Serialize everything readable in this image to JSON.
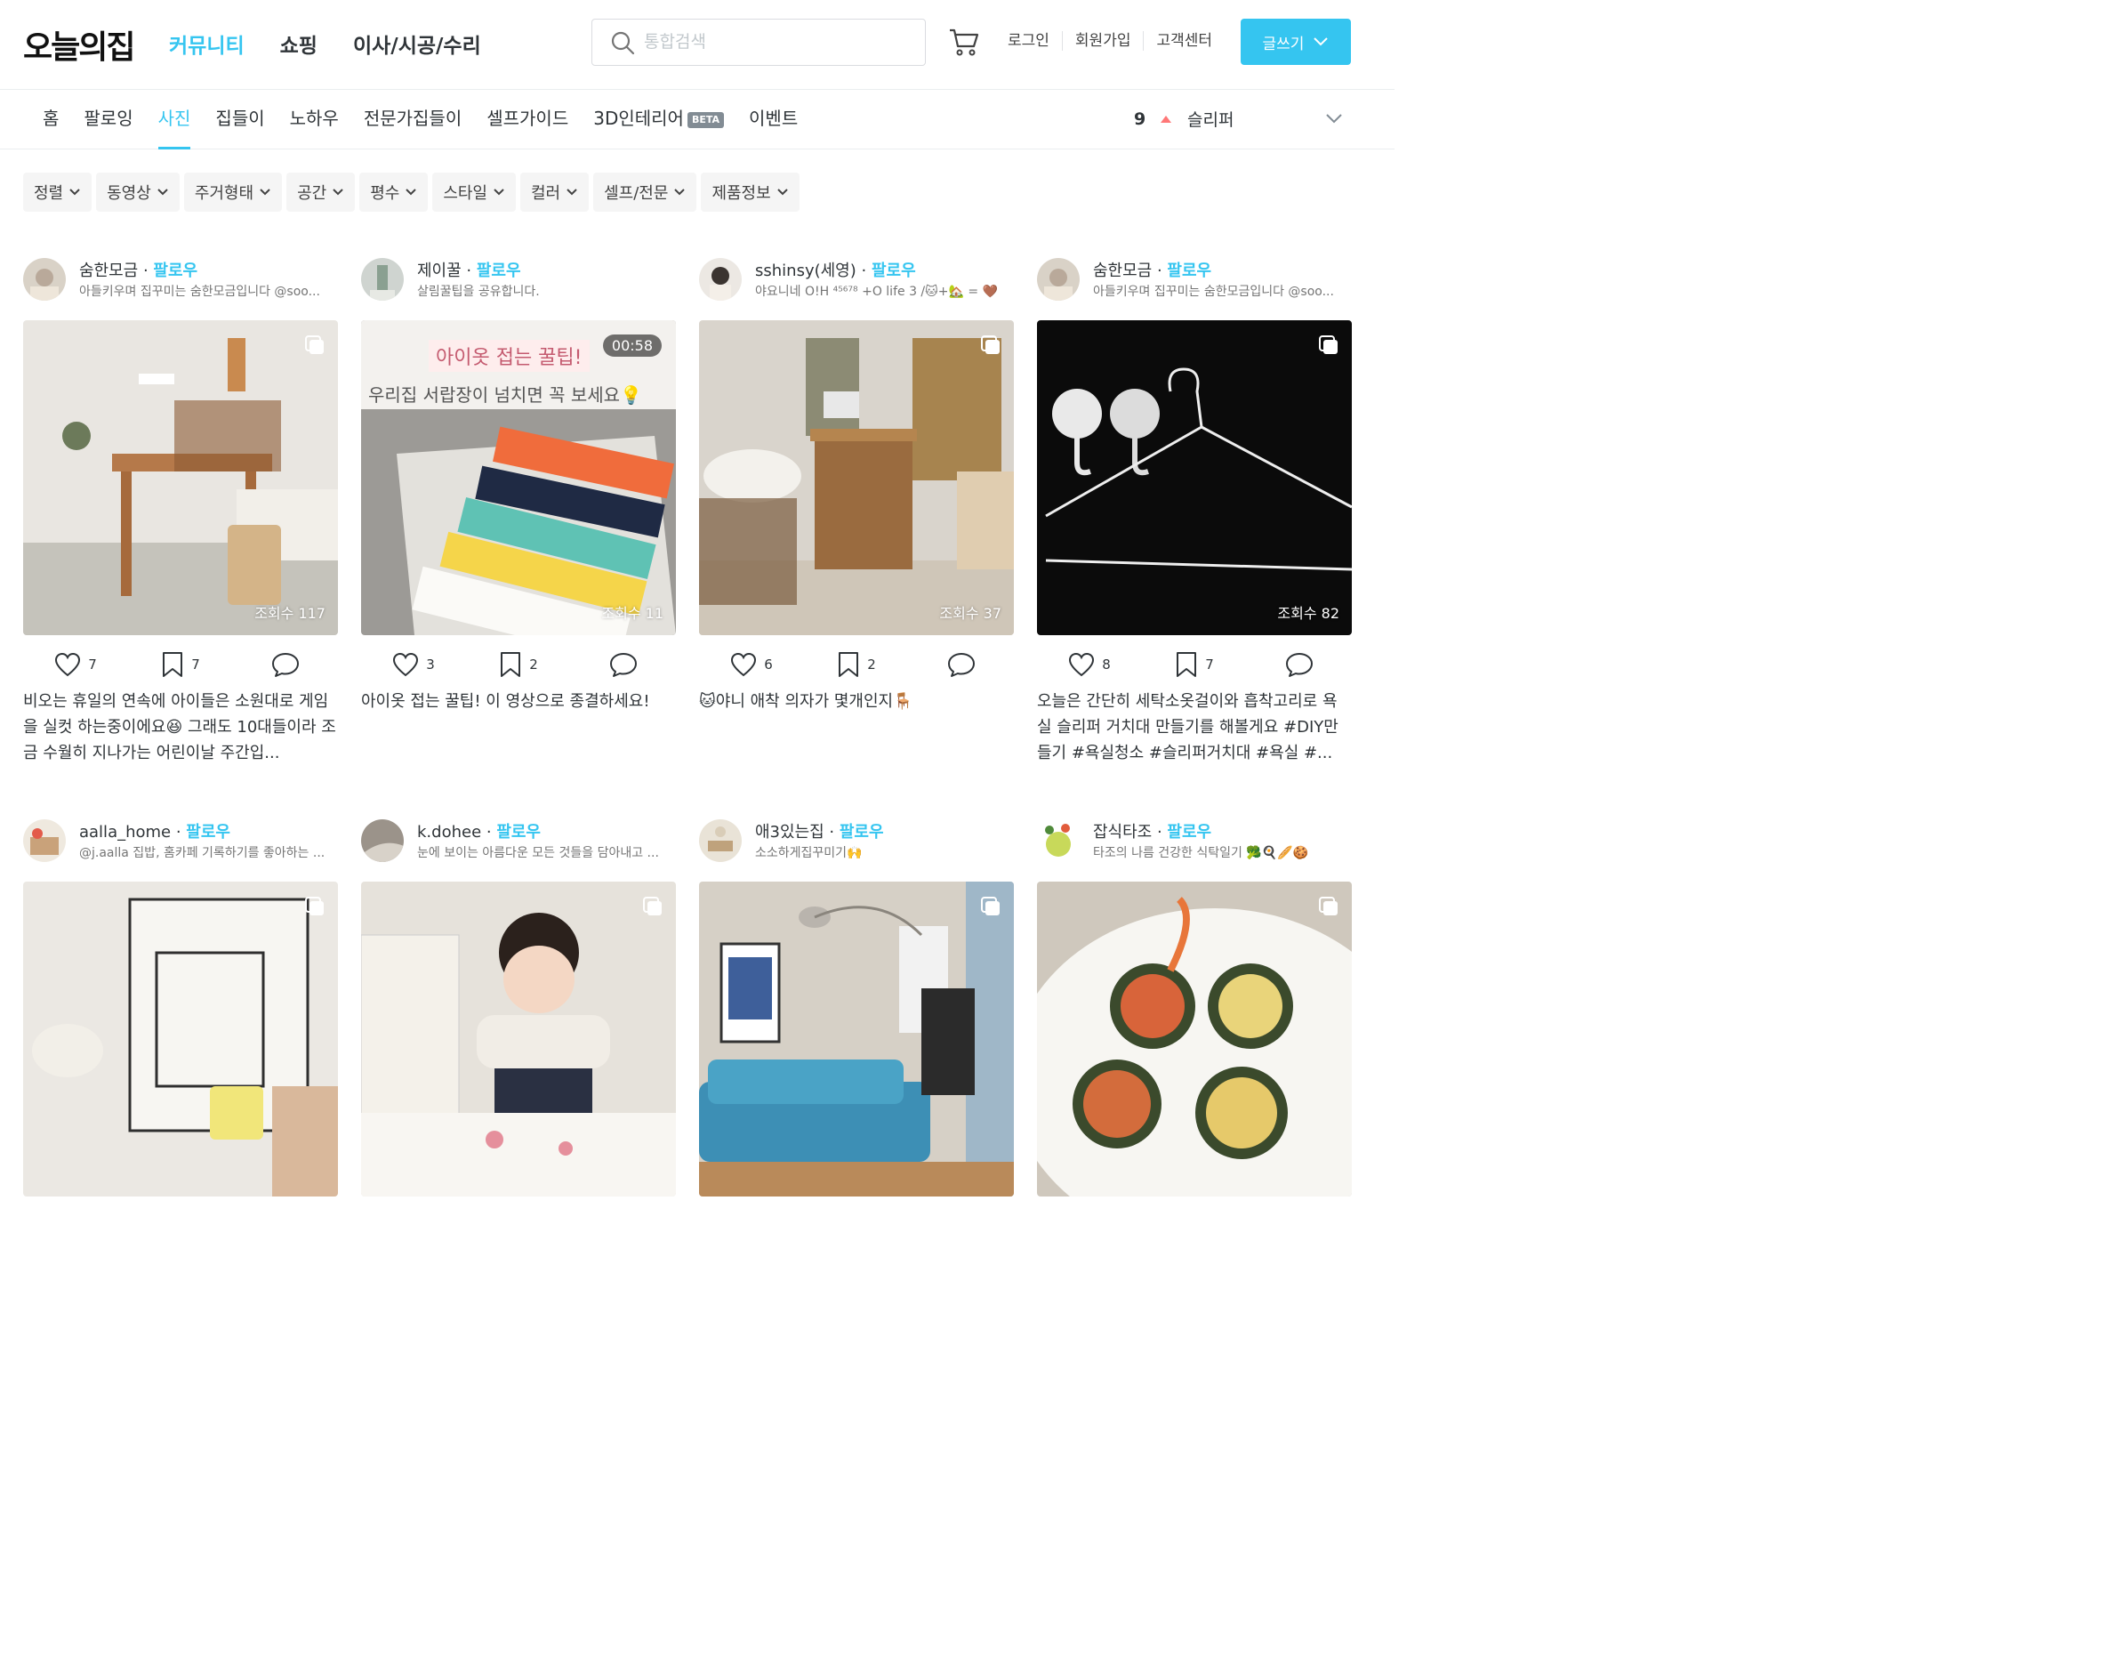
{
  "header": {
    "logo": "오늘의집",
    "nav": [
      "커뮤니티",
      "쇼핑",
      "이사/시공/수리"
    ],
    "search_placeholder": "통합검색",
    "user_links": [
      "로그인",
      "회원가입",
      "고객센터"
    ],
    "write_label": "글쓰기"
  },
  "subnav": {
    "items": [
      "홈",
      "팔로잉",
      "사진",
      "집들이",
      "노하우",
      "전문가집들이",
      "셀프가이드",
      "3D인테리어",
      "이벤트"
    ],
    "beta_label": "BETA",
    "ranking_number": "9",
    "ranking_keyword": "슬리퍼"
  },
  "filters": [
    "정렬",
    "동영상",
    "주거형태",
    "공간",
    "평수",
    "스타일",
    "컬러",
    "셀프/전문",
    "제품정보"
  ],
  "cards": [
    {
      "user": "숨한모금",
      "follow": "팔로우",
      "bio": "아들키우며 집꾸미는 숨한모금입니다 @soo...",
      "views": "조회수 117",
      "likes": "7",
      "scraps": "7",
      "caption": "비오는 휴일의 연속에 아이들은 소원대로 게임을 실컷 하는중이에요😆 그래도 10대들이라 조금 수월히 지나가는 어린이날 주간입..."
    },
    {
      "user": "제이꿀",
      "follow": "팔로우",
      "bio": "살림꿀팁을 공유합니다.",
      "views": "조회수 11",
      "duration": "00:58",
      "overlay_title": "아이옷 접는 꿀팁!",
      "overlay_sub": "우리집 서랍장이 넘치면 꼭 보세요💡",
      "likes": "3",
      "scraps": "2",
      "caption": "아이옷 접는 꿀팁! 이 영상으로 종결하세요!"
    },
    {
      "user": "sshinsy(세영)",
      "follow": "팔로우",
      "bio": "야요니네 O!H ⁴⁵⁶⁷⁸ +O life 3 /🐱+🏡 = 🤎",
      "views": "조회수 37",
      "likes": "6",
      "scraps": "2",
      "caption": "🐱야니 애착 의자가 몇개인지🪑"
    },
    {
      "user": "숨한모금",
      "follow": "팔로우",
      "bio": "아들키우며 집꾸미는 숨한모금입니다 @soo...",
      "views": "조회수 82",
      "likes": "8",
      "scraps": "7",
      "caption": "오늘은 간단히 세탁소옷걸이와 흡착고리로 욕실 슬리퍼 거치대 만들기를 해볼게요 #DIY만들기 #욕실청소 #슬리퍼거치대 #욕실 #..."
    },
    {
      "user": "aalla_home",
      "follow": "팔로우",
      "bio": "@j.aalla 집밥, 홈카페 기록하기를 좋아하는 ..."
    },
    {
      "user": "k.dohee",
      "follow": "팔로우",
      "bio": "눈에 보이는 아름다운 모든 것들을 담아내고 ..."
    },
    {
      "user": "애3있는집",
      "follow": "팔로우",
      "bio": "소소하게집꾸미기🙌"
    },
    {
      "user": "잡식타조",
      "follow": "팔로우",
      "bio": "타조의 나름 건강한 식탁일기 🥦🍳🥖🍪"
    }
  ]
}
